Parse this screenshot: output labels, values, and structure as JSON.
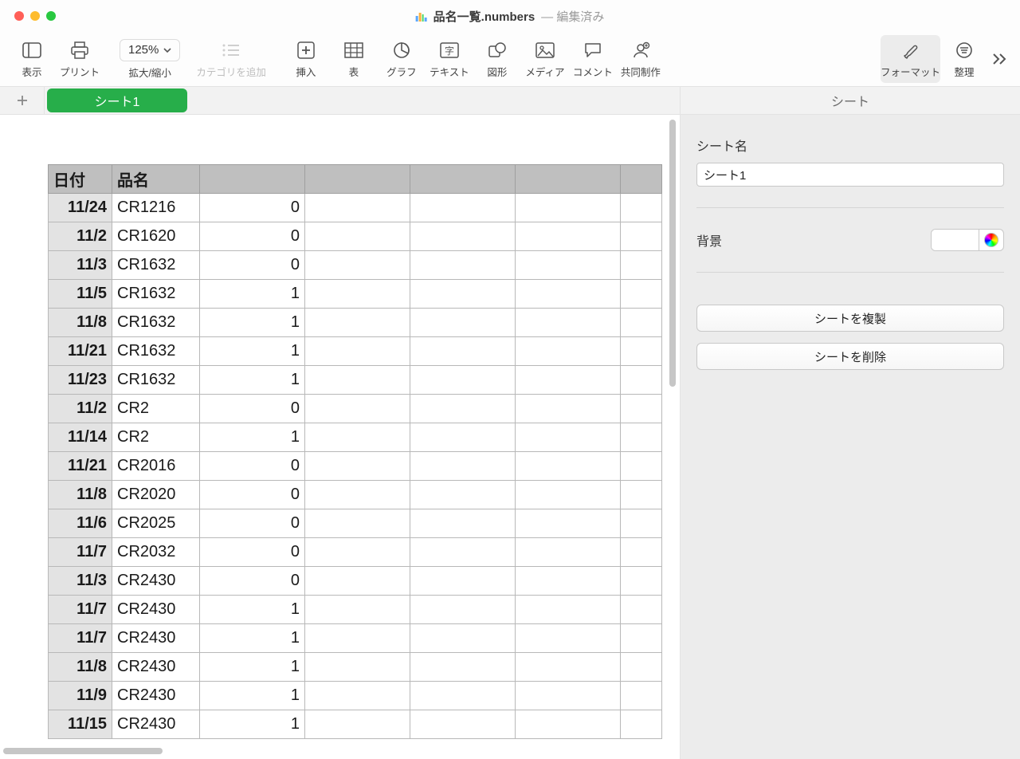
{
  "window": {
    "filename": "品名一覧.numbers",
    "edited": "編集済み"
  },
  "toolbar": {
    "view": "表示",
    "print": "プリント",
    "zoom_group": "拡大/縮小",
    "zoom_value": "125%",
    "add_category": "カテゴリを追加",
    "insert": "挿入",
    "table": "表",
    "chart": "グラフ",
    "text": "テキスト",
    "shape": "図形",
    "media": "メディア",
    "comment": "コメント",
    "collaborate": "共同制作",
    "format": "フォーマット",
    "organize": "整理"
  },
  "tabs": {
    "sheet1": "シート1"
  },
  "inspector": {
    "title": "シート",
    "sheet_name_label": "シート名",
    "sheet_name_value": "シート1",
    "background_label": "背景",
    "duplicate": "シートを複製",
    "delete": "シートを削除"
  },
  "table": {
    "headers": [
      "日付",
      "品名",
      "",
      "",
      "",
      "",
      ""
    ],
    "rows": [
      {
        "date": "11/24",
        "name": "CR1216",
        "val": "0"
      },
      {
        "date": "11/2",
        "name": "CR1620",
        "val": "0"
      },
      {
        "date": "11/3",
        "name": "CR1632",
        "val": "0"
      },
      {
        "date": "11/5",
        "name": "CR1632",
        "val": "1"
      },
      {
        "date": "11/8",
        "name": "CR1632",
        "val": "1"
      },
      {
        "date": "11/21",
        "name": "CR1632",
        "val": "1"
      },
      {
        "date": "11/23",
        "name": "CR1632",
        "val": "1"
      },
      {
        "date": "11/2",
        "name": "CR2",
        "val": "0"
      },
      {
        "date": "11/14",
        "name": "CR2",
        "val": "1"
      },
      {
        "date": "11/21",
        "name": "CR2016",
        "val": "0"
      },
      {
        "date": "11/8",
        "name": "CR2020",
        "val": "0"
      },
      {
        "date": "11/6",
        "name": "CR2025",
        "val": "0"
      },
      {
        "date": "11/7",
        "name": "CR2032",
        "val": "0"
      },
      {
        "date": "11/3",
        "name": "CR2430",
        "val": "0"
      },
      {
        "date": "11/7",
        "name": "CR2430",
        "val": "1"
      },
      {
        "date": "11/7",
        "name": "CR2430",
        "val": "1"
      },
      {
        "date": "11/8",
        "name": "CR2430",
        "val": "1"
      },
      {
        "date": "11/9",
        "name": "CR2430",
        "val": "1"
      },
      {
        "date": "11/15",
        "name": "CR2430",
        "val": "1"
      }
    ]
  }
}
